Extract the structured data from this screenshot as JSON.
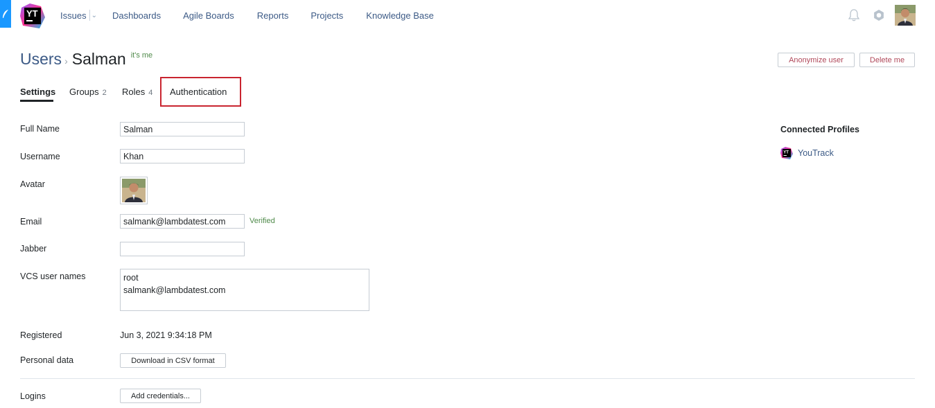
{
  "nav": {
    "items": [
      "Issues",
      "Dashboards",
      "Agile Boards",
      "Reports",
      "Projects",
      "Knowledge Base"
    ],
    "logo_text": "YT"
  },
  "header": {
    "breadcrumb_root": "Users",
    "breadcrumb_sep": "›",
    "user_name": "Salman",
    "its_me": "it's me",
    "anonymize_label": "Anonymize user",
    "delete_label": "Delete me"
  },
  "tabs": [
    {
      "label": "Settings",
      "count": ""
    },
    {
      "label": "Groups",
      "count": "2"
    },
    {
      "label": "Roles",
      "count": "4"
    },
    {
      "label": "Authentication",
      "count": ""
    }
  ],
  "form": {
    "full_name_label": "Full Name",
    "full_name_value": "Salman",
    "username_label": "Username",
    "username_value": "Khan",
    "avatar_label": "Avatar",
    "email_label": "Email",
    "email_value": "salmank@lambdatest.com",
    "email_status": "Verified",
    "jabber_label": "Jabber",
    "jabber_value": "",
    "vcs_label": "VCS user names",
    "vcs_values": [
      "root",
      "salmank@lambdatest.com"
    ],
    "registered_label": "Registered",
    "registered_value": "Jun 3, 2021 9:34:18 PM",
    "personal_data_label": "Personal data",
    "download_csv_label": "Download in CSV format",
    "logins_label": "Logins",
    "add_credentials_label": "Add credentials..."
  },
  "connected_profiles": {
    "title": "Connected Profiles",
    "items": [
      "YouTrack"
    ]
  },
  "colors": {
    "link": "#3c5a86",
    "accent_blue": "#1a98ff",
    "verified_green": "#4f8a4a",
    "danger": "#b0485a",
    "highlight": "#c9242f"
  }
}
